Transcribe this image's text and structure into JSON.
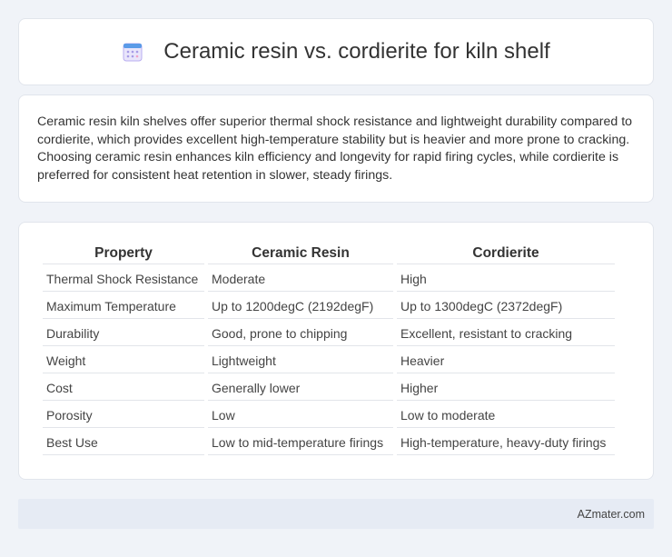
{
  "header": {
    "title": "Ceramic resin vs. cordierite for kiln shelf",
    "icon": "calendar-icon",
    "icon_color": "#8a7bd8"
  },
  "summary": {
    "text": "Ceramic resin kiln shelves offer superior thermal shock resistance and lightweight durability compared to cordierite, which provides excellent high-temperature stability but is heavier and more prone to cracking. Choosing ceramic resin enhances kiln efficiency and longevity for rapid firing cycles, while cordierite is preferred for consistent heat retention in slower, steady firings."
  },
  "table": {
    "headers": [
      "Property",
      "Ceramic Resin",
      "Cordierite"
    ],
    "rows": [
      [
        "Thermal Shock Resistance",
        "Moderate",
        "High"
      ],
      [
        "Maximum Temperature",
        "Up to 1200degC (2192degF)",
        "Up to 1300degC (2372degF)"
      ],
      [
        "Durability",
        "Good, prone to chipping",
        "Excellent, resistant to cracking"
      ],
      [
        "Weight",
        "Lightweight",
        "Heavier"
      ],
      [
        "Cost",
        "Generally lower",
        "Higher"
      ],
      [
        "Porosity",
        "Low",
        "Low to moderate"
      ],
      [
        "Best Use",
        "Low to mid-temperature firings",
        "High-temperature, heavy-duty firings"
      ]
    ]
  },
  "footer": {
    "brand": "AZmater.com"
  }
}
